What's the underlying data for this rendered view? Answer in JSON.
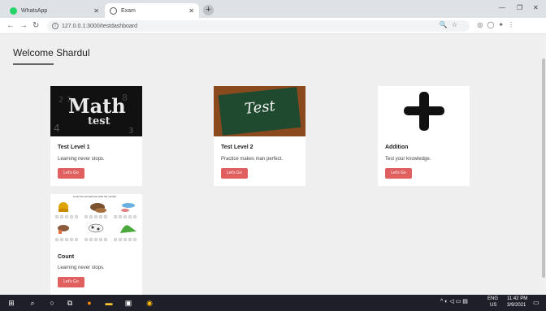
{
  "browser": {
    "tabs": [
      {
        "label": "WhatsApp",
        "favicon_color": "#25d366"
      },
      {
        "label": "Exam",
        "favicon_color": "#555555"
      }
    ],
    "url": "127.0.0.1:3000/testdashboard"
  },
  "page": {
    "welcome": "Welcome Shardul"
  },
  "cards": [
    {
      "title": "Test Level 1",
      "desc": "Learning never stops.",
      "button": "Let's Go",
      "thumb_text": "Math",
      "thumb_sub": "test"
    },
    {
      "title": "Test Level 2",
      "desc": "Practice makes man perfect.",
      "button": "Let's Go",
      "thumb_text": "Test"
    },
    {
      "title": "Addition",
      "desc": "Test your knowledge.",
      "button": "Let's Go"
    },
    {
      "title": "Count",
      "desc": "Learning never stops.",
      "button": "Let's Go",
      "thumb_text": "Count the animals and write the number"
    }
  ],
  "taskbar": {
    "lang": "ENG",
    "region": "US",
    "time": "11:42 PM",
    "date": "3/9/2021"
  },
  "colors": {
    "accent_button": "#e05f5f",
    "page_bg": "#f0eff0",
    "taskbar_bg": "#1f1f2a"
  }
}
